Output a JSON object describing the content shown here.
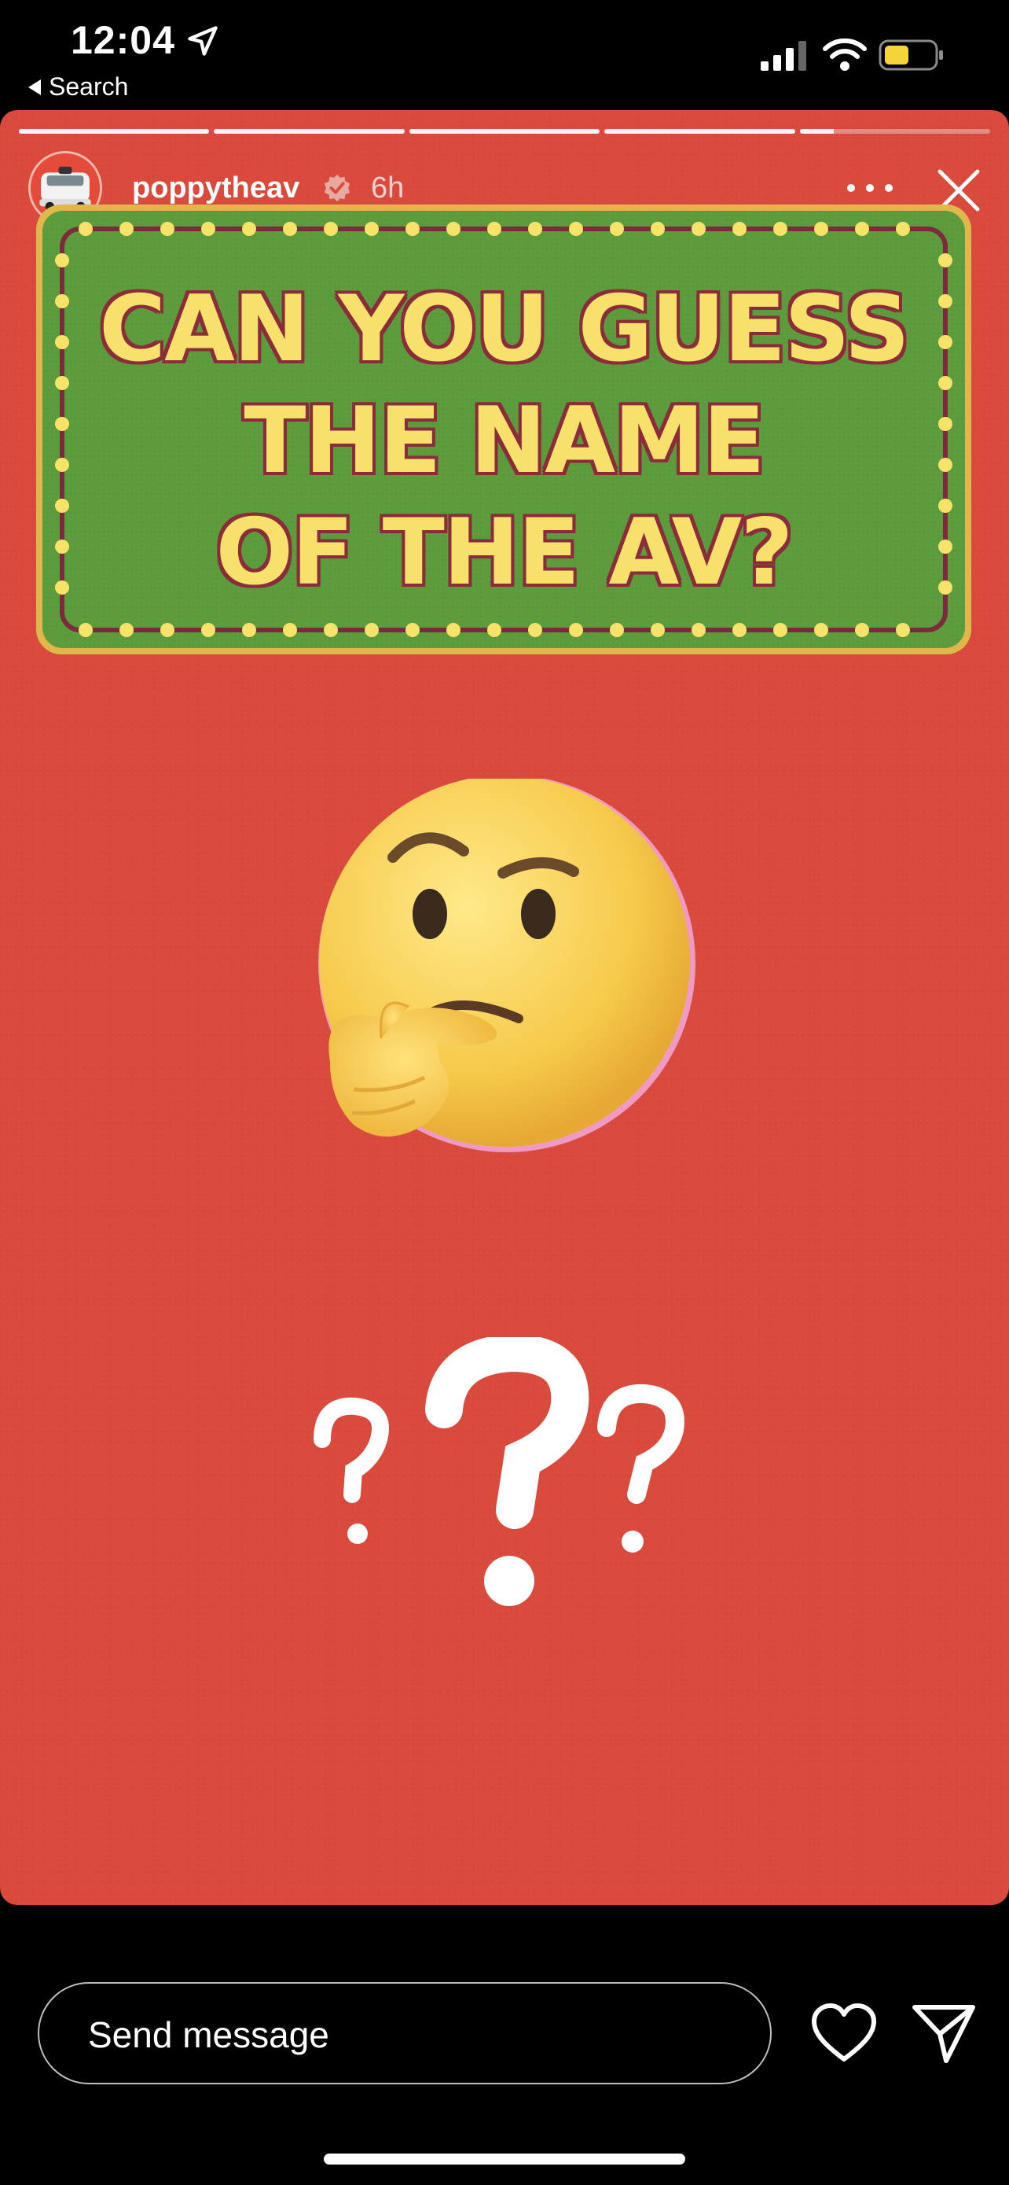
{
  "status_bar": {
    "time": "12:04",
    "back_label": "Search"
  },
  "story": {
    "progress_segments": [
      1,
      1,
      1,
      1,
      0.18
    ],
    "username": "poppytheav",
    "age": "6h",
    "sign_lines": [
      "CAN YOU GUESS",
      "THE NAME",
      "OF THE AV?"
    ]
  },
  "footer": {
    "message_placeholder": "Send message"
  },
  "icons": {
    "location": "location-arrow-icon",
    "signal": "cellular-signal-icon",
    "wifi": "wifi-icon",
    "battery": "battery-icon",
    "verified": "verified-badge-icon",
    "more": "more-dots-icon",
    "close": "close-icon",
    "heart": "heart-icon",
    "send": "send-icon"
  },
  "colors": {
    "story_bg": "#d94a3c",
    "sign_green": "#5b9b3c",
    "sign_text": "#f7e06b",
    "battery": "#f5d33b"
  }
}
